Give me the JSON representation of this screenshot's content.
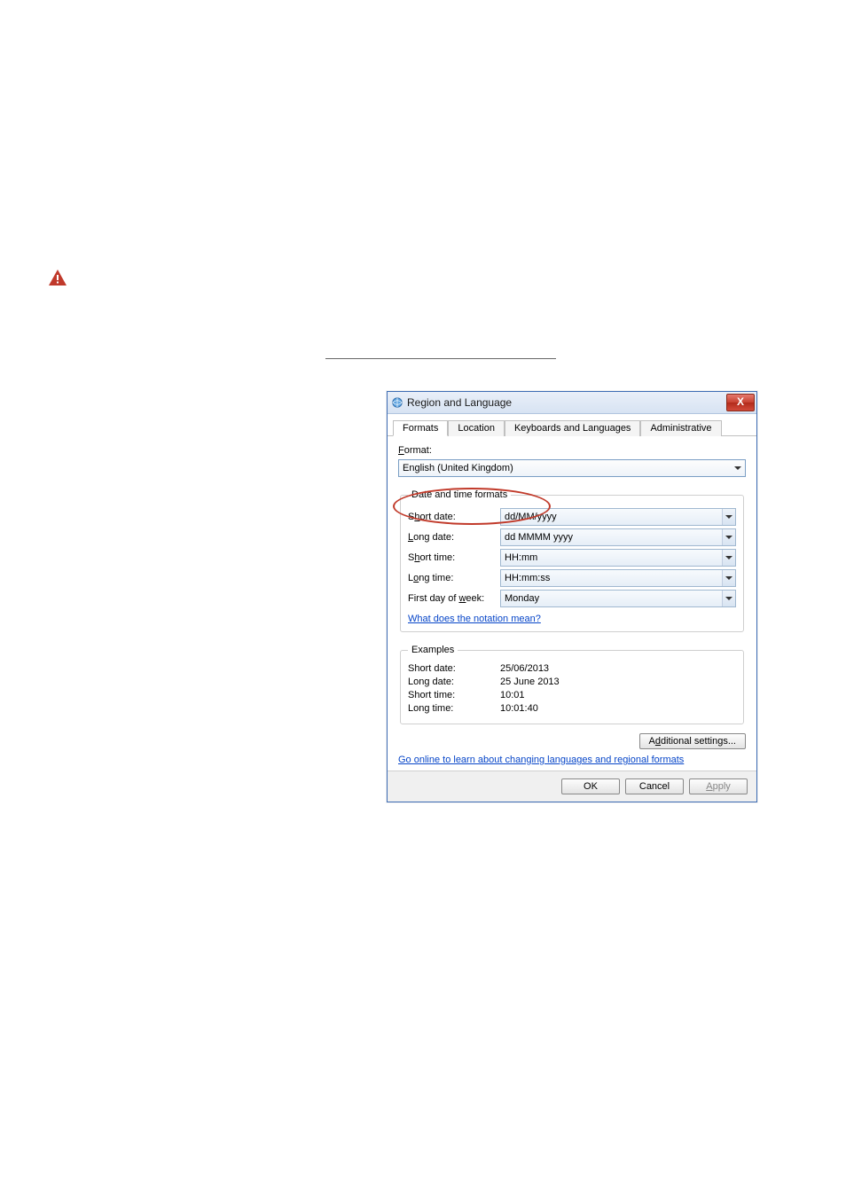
{
  "dialog": {
    "title": "Region and Language",
    "close": "X",
    "tabs": [
      "Formats",
      "Location",
      "Keyboards and Languages",
      "Administrative"
    ],
    "format_label_pre": "F",
    "format_label_post": "ormat:",
    "format_value": "English (United Kingdom)",
    "dtf": {
      "legend": "Date and time formats",
      "short_date": {
        "label_pre": "S",
        "label_u": "h",
        "label_post": "ort date:",
        "value": "dd/MM/yyyy"
      },
      "long_date": {
        "label_u": "L",
        "label_post": "ong date:",
        "value": "dd MMMM yyyy"
      },
      "short_time": {
        "label_pre": "S",
        "label_u": "h",
        "label_post": "ort time:",
        "value": "HH:mm"
      },
      "long_time": {
        "label_pre": "L",
        "label_u": "o",
        "label_post": "ng time:",
        "value": "HH:mm:ss"
      },
      "first_day": {
        "label_pre": "First day of ",
        "label_u": "w",
        "label_post": "eek:",
        "value": "Monday"
      },
      "notation_link": "What does the notation mean?"
    },
    "examples": {
      "legend": "Examples",
      "short_date": {
        "label": "Short date:",
        "value": "25/06/2013"
      },
      "long_date": {
        "label": "Long date:",
        "value": "25 June 2013"
      },
      "short_time": {
        "label": "Short time:",
        "value": "10:01"
      },
      "long_time": {
        "label": "Long time:",
        "value": "10:01:40"
      }
    },
    "additional_pre": "A",
    "additional_u": "d",
    "additional_post": "ditional settings...",
    "go_online": "Go online to learn about changing languages and regional formats",
    "ok": "OK",
    "cancel": "Cancel",
    "apply_u": "A",
    "apply_post": "pply"
  }
}
